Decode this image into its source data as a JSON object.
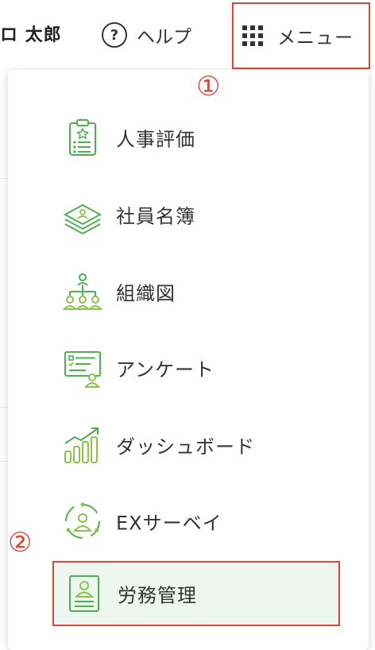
{
  "header": {
    "user_name": "ロ 太郎",
    "help_label": "ヘルプ",
    "menu_label": "メニュー"
  },
  "annotations": {
    "step1": "①",
    "step2": "②"
  },
  "menu": {
    "items": [
      {
        "label": "人事評価",
        "icon": "clipboard-icon"
      },
      {
        "label": "社員名簿",
        "icon": "stack-icon"
      },
      {
        "label": "組織図",
        "icon": "org-chart-icon"
      },
      {
        "label": "アンケート",
        "icon": "survey-icon"
      },
      {
        "label": "ダッシュボード",
        "icon": "dashboard-chart-icon"
      },
      {
        "label": "EXサーベイ",
        "icon": "ex-survey-icon"
      },
      {
        "label": "労務管理",
        "icon": "labor-management-icon",
        "selected": true
      }
    ]
  },
  "colors": {
    "accent_red": "#e04536",
    "icon_green": "#4caf50",
    "selected_bg": "#eef7ef"
  }
}
